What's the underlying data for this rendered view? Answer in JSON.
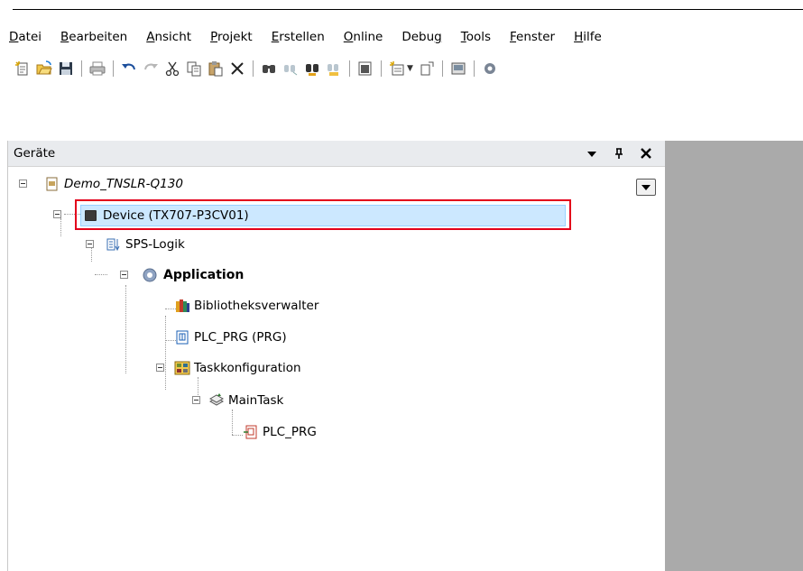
{
  "menu": [
    {
      "label": "Datei",
      "accel": "D"
    },
    {
      "label": "Bearbeiten",
      "accel": "B"
    },
    {
      "label": "Ansicht",
      "accel": "A"
    },
    {
      "label": "Projekt",
      "accel": "P"
    },
    {
      "label": "Erstellen",
      "accel": "E"
    },
    {
      "label": "Online",
      "accel": "O"
    },
    {
      "label": "Debug",
      "accel": "g"
    },
    {
      "label": "Tools",
      "accel": "T"
    },
    {
      "label": "Fenster",
      "accel": "F"
    },
    {
      "label": "Hilfe",
      "accel": "H"
    }
  ],
  "toolbar_icons": [
    "new-project-icon",
    "open-folder-icon",
    "save-icon",
    "print-icon",
    "undo-icon",
    "redo-icon",
    "cut-icon",
    "copy-icon",
    "paste-icon",
    "delete-icon",
    "find-icon",
    "find-next-icon",
    "replace-icon",
    "replace-all-icon",
    "clipboard-icon",
    "add-object-icon",
    "insert-icon",
    "device-screen-icon"
  ],
  "panel": {
    "title": "Geräte",
    "menu_symbol": "▾",
    "pin_symbol": "ᵖ",
    "close_symbol": "✕"
  },
  "tree": {
    "project": "Demo_TNSLR-Q130",
    "device": "Device (TX707-P3CV01)",
    "plc_logic": "SPS-Logik",
    "application": "Application",
    "library_manager": "Bibliotheksverwalter",
    "plc_prg": "PLC_PRG (PRG)",
    "task_config": "Taskkonfiguration",
    "main_task": "MainTask",
    "task_call": "PLC_PRG"
  },
  "colors": {
    "selection": "#cce8ff",
    "highlight_border": "#e3001b",
    "panel_header": "#e9ebee",
    "workspace": "#aaaaaa"
  }
}
